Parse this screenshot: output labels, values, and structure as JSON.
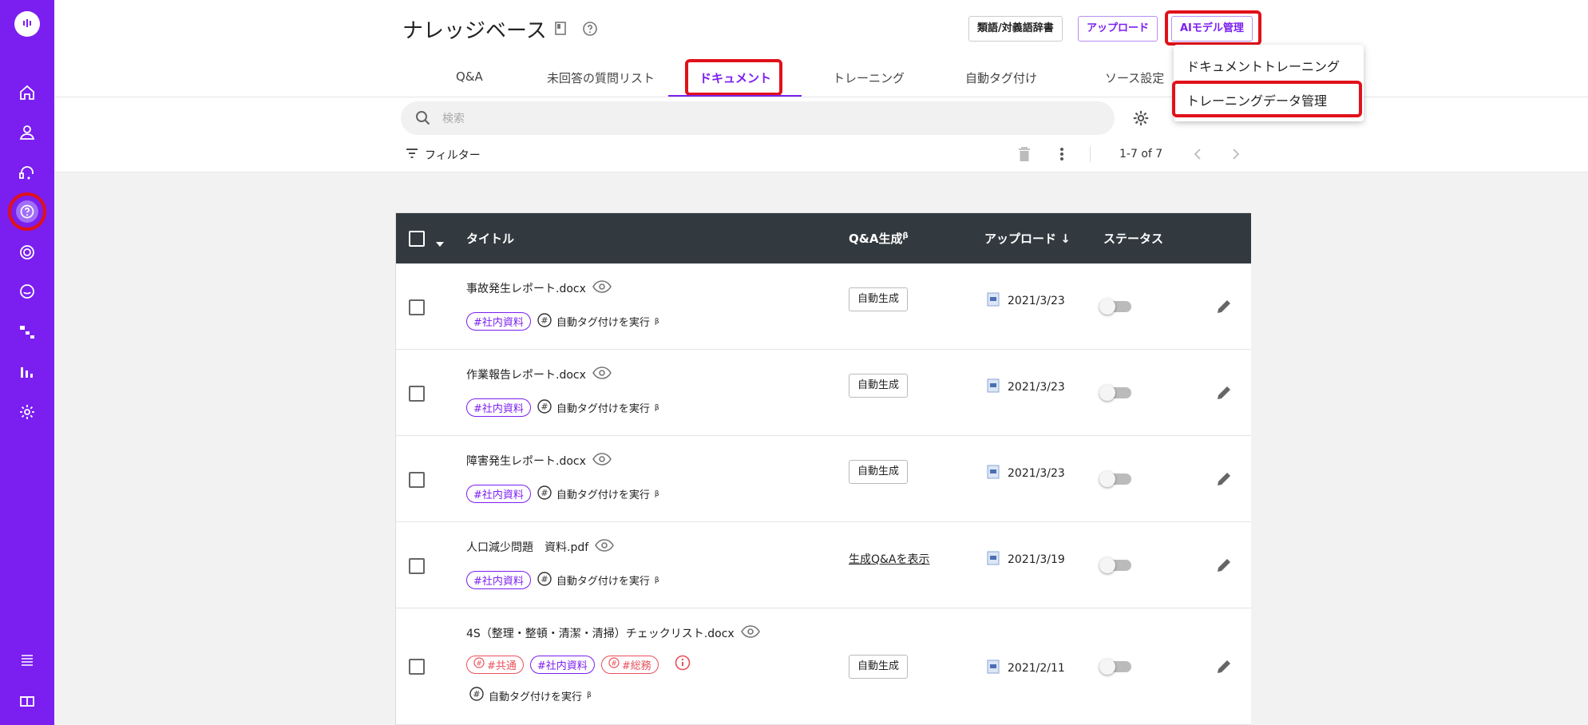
{
  "header": {
    "title": "ナレッジベース",
    "buttons": {
      "synonym_dictionary": "類語/対義語辞書",
      "upload": "アップロード",
      "ai_model": "AIモデル管理"
    }
  },
  "tabs": [
    {
      "label": "Q&A"
    },
    {
      "label": "未回答の質問リスト"
    },
    {
      "label": "ドキュメント"
    },
    {
      "label": "トレーニング"
    },
    {
      "label": "自動タグ付け"
    },
    {
      "label": "ソース設定"
    }
  ],
  "search": {
    "placeholder": "検索"
  },
  "filter": {
    "label": "フィルター"
  },
  "pagination": {
    "range": "1-7 of 7"
  },
  "dropdown_menu": {
    "items": [
      "ドキュメントトレーニング",
      "トレーニングデータ管理"
    ]
  },
  "table": {
    "columns": {
      "title": "タイトル",
      "qa_generation": "Q&A生成",
      "qa_generation_sup": "β",
      "upload": "アップロード",
      "status": "ステータス"
    },
    "auto_tag_label": "自動タグ付けを実行",
    "beta": "β",
    "rows": [
      {
        "file": "事故発生レポート.docx",
        "tags": [
          "#社内資料"
        ],
        "generate": "自動生成",
        "date": "2021/3/23"
      },
      {
        "file": "作業報告レポート.docx",
        "tags": [
          "#社内資料"
        ],
        "generate": "自動生成",
        "date": "2021/3/23"
      },
      {
        "file": "障害発生レポート.docx",
        "tags": [
          "#社内資料"
        ],
        "generate": "自動生成",
        "date": "2021/3/23"
      },
      {
        "file": "人口減少問題　資料.pdf",
        "tags": [
          "#社内資料"
        ],
        "generate_link": "生成Q&Aを表示",
        "date": "2021/3/19"
      },
      {
        "file": "4S（整理・整頓・清潔・清掃）チェックリスト.docx",
        "tags": [
          "#共通",
          "#社内資料",
          "#総務"
        ],
        "generate": "自動生成",
        "date": "2021/2/11"
      }
    ]
  },
  "colors": {
    "accent": "#7b1ff0",
    "highlight": "#e0111a",
    "table_header": "#323a3f"
  }
}
